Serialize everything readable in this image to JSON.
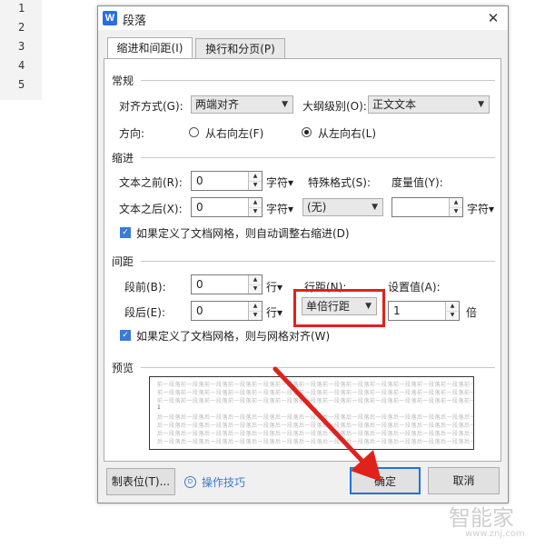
{
  "gutter": {
    "lines": [
      "1",
      "2",
      "3",
      "4",
      "5"
    ]
  },
  "dialog": {
    "icon_letter": "W",
    "title": "段落",
    "tabs": [
      "缩进和间距(I)",
      "换行和分页(P)"
    ]
  },
  "general": {
    "section": "常规",
    "align_label": "对齐方式(G):",
    "align_value": "两端对齐",
    "outline_label": "大纲级别(O):",
    "outline_value": "正文文本",
    "direction_label": "方向:",
    "rtl_label": "从右向左(F)",
    "ltr_label": "从左向右(L)",
    "direction_selected": "ltr"
  },
  "indent": {
    "section": "缩进",
    "before_label": "文本之前(R):",
    "before_value": "0",
    "before_unit": "字符▾",
    "after_label": "文本之后(X):",
    "after_value": "0",
    "after_unit": "字符▾",
    "special_label": "特殊格式(S):",
    "special_value": "(无)",
    "measure_label": "度量值(Y):",
    "measure_value": "",
    "measure_unit": "字符▾",
    "grid_checkbox": "如果定义了文档网格，则自动调整右缩进(D)",
    "grid_checked": true
  },
  "spacing": {
    "section": "间距",
    "before_label": "段前(B):",
    "before_value": "0",
    "before_unit": "行▾",
    "after_label": "段后(E):",
    "after_value": "0",
    "after_unit": "行▾",
    "line_label": "行距(N):",
    "line_value": "单倍行距",
    "setting_label": "设置值(A):",
    "setting_value": "1",
    "setting_unit": "倍",
    "grid_checkbox": "如果定义了文档网格，则与网格对齐(W)",
    "grid_checked": true
  },
  "preview": {
    "section": "预览",
    "prev_text": "前一段落前一段落前一段落前一段落前一段落前一段落前一段落前一段落前一段落前一段落前一段落前一段落前一段落前一段落",
    "cur_text": "1",
    "next_text": "后一段落后一段落后一段落后一段落后一段落后一段落后一段落后一段落后一段落后一段落后一段落后一段落后一段落后一段落"
  },
  "footer": {
    "tabs_button": "制表位(T)...",
    "tips_icon": "D",
    "tips_link": "操作技巧",
    "ok_button": "确定",
    "cancel_button": "取消"
  },
  "watermark": {
    "brand": "智能家",
    "url": "www.znj.com"
  },
  "colors": {
    "highlight": "#e0221c",
    "accent": "#1e73d8"
  }
}
